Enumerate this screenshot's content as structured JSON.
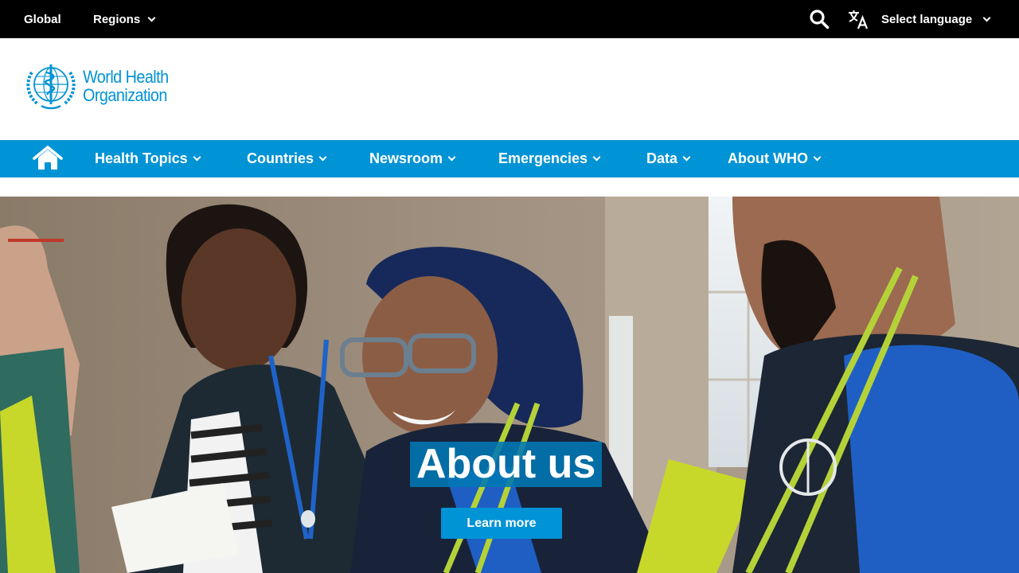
{
  "topbar": {
    "global_label": "Global",
    "regions_label": "Regions",
    "language_label": "Select language"
  },
  "logo": {
    "line1": "World Health",
    "line2": "Organization"
  },
  "nav": {
    "items": [
      {
        "label": "Health Topics"
      },
      {
        "label": "Countries"
      },
      {
        "label": "Newsroom"
      },
      {
        "label": "Emergencies"
      },
      {
        "label": "Data"
      },
      {
        "label": "About WHO"
      }
    ]
  },
  "hero": {
    "title": "About us",
    "button_label": "Learn more"
  },
  "icons": {
    "search": "search-icon",
    "translate": "translate-icon",
    "home": "home-icon",
    "emblem": "who-emblem-icon"
  },
  "colors": {
    "topbar": "#000000",
    "brand_blue": "#0093d5",
    "hero_title_bg": "#0077b4"
  }
}
